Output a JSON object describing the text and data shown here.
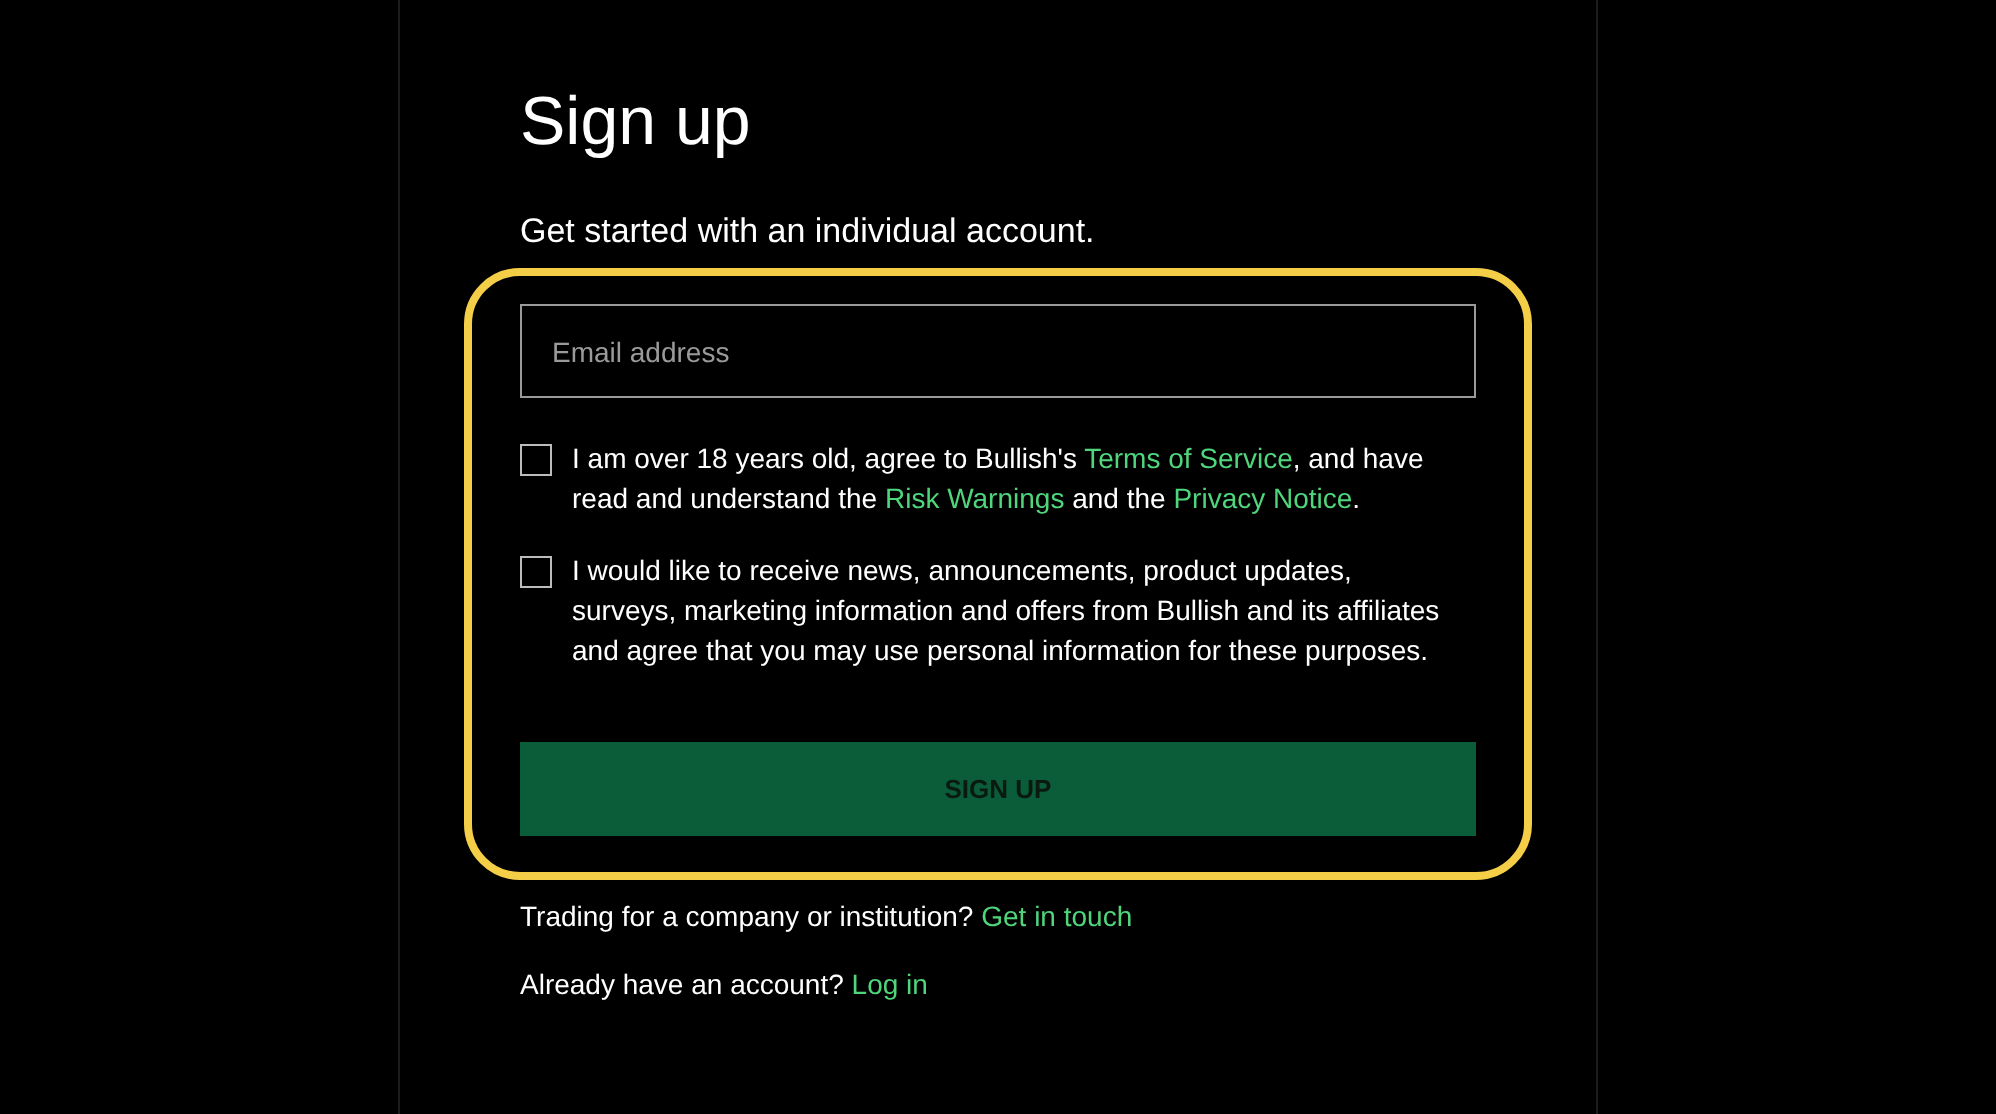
{
  "title": "Sign up",
  "subtitle": "Get started with an individual account.",
  "email_field": {
    "placeholder": "Email address"
  },
  "consents": [
    {
      "checked": false,
      "parts": [
        {
          "text": "I am over 18 years old, agree to Bullish's ",
          "link": false
        },
        {
          "text": "Terms of Service",
          "link": true
        },
        {
          "text": ", and have read and understand the ",
          "link": false
        },
        {
          "text": "Risk Warnings",
          "link": true
        },
        {
          "text": " and the ",
          "link": false
        },
        {
          "text": "Privacy Notice",
          "link": true
        },
        {
          "text": ".",
          "link": false
        }
      ]
    },
    {
      "checked": false,
      "parts": [
        {
          "text": "I would like to receive news, announcements, product updates, surveys, marketing information and offers from Bullish and its affiliates and agree that you may use personal information for these purposes.",
          "link": false
        }
      ]
    }
  ],
  "submit_button": "SIGN UP",
  "footer_lines": [
    {
      "text": "Trading for a company or institution?",
      "link": "Get in touch"
    },
    {
      "text": "Already have an account?",
      "link": "Log in"
    }
  ]
}
